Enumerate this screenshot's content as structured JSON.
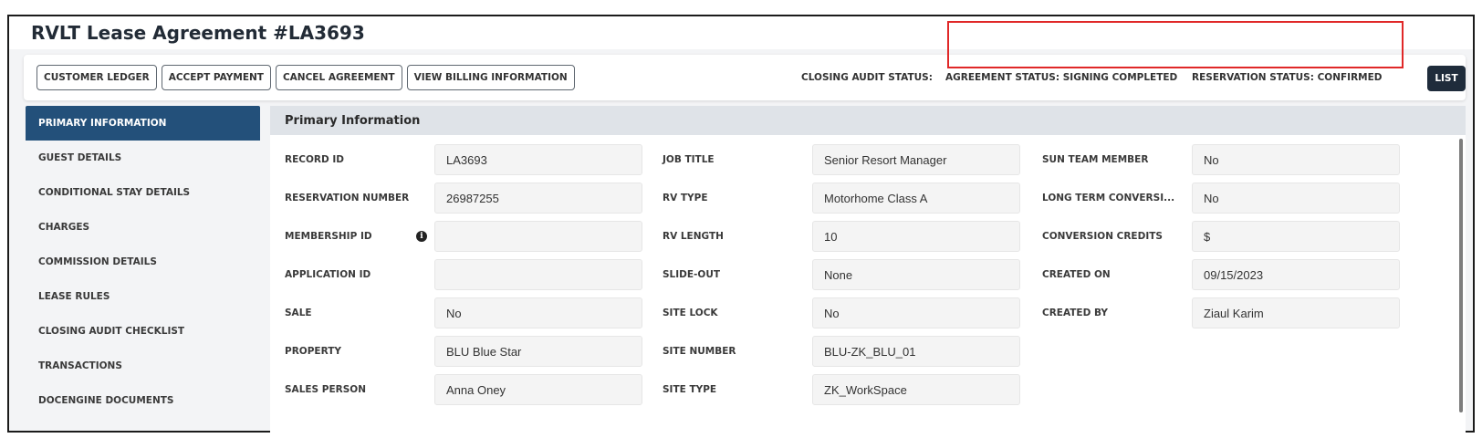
{
  "page": {
    "title": "RVLT Lease Agreement #LA3693"
  },
  "toolbar": {
    "buttons": [
      "CUSTOMER LEDGER",
      "ACCEPT PAYMENT",
      "CANCEL AGREEMENT",
      "VIEW BILLING INFORMATION"
    ],
    "closing_audit_status": "CLOSING AUDIT STATUS:",
    "agreement_status": "AGREEMENT STATUS: SIGNING COMPLETED",
    "reservation_status": "RESERVATION STATUS: CONFIRMED",
    "list_label": "LIST"
  },
  "sidebar": {
    "items": [
      {
        "label": "PRIMARY INFORMATION",
        "active": true
      },
      {
        "label": "GUEST DETAILS"
      },
      {
        "label": "CONDITIONAL STAY DETAILS"
      },
      {
        "label": "CHARGES"
      },
      {
        "label": "COMMISSION DETAILS"
      },
      {
        "label": "LEASE RULES"
      },
      {
        "label": "CLOSING AUDIT CHECKLIST"
      },
      {
        "label": "TRANSACTIONS"
      },
      {
        "label": "DOCENGINE DOCUMENTS"
      }
    ]
  },
  "panel": {
    "title": "Primary Information",
    "columns": [
      [
        {
          "label": "RECORD ID",
          "value": "LA3693"
        },
        {
          "label": "RESERVATION NUMBER",
          "value": "26987255"
        },
        {
          "label": "MEMBERSHIP ID",
          "value": "",
          "info": true
        },
        {
          "label": "APPLICATION ID",
          "value": ""
        },
        {
          "label": "SALE",
          "value": "No"
        },
        {
          "label": "PROPERTY",
          "value": "BLU Blue Star"
        },
        {
          "label": "SALES PERSON",
          "value": "Anna Oney"
        }
      ],
      [
        {
          "label": "JOB TITLE",
          "value": "Senior Resort Manager"
        },
        {
          "label": "RV TYPE",
          "value": "Motorhome Class A"
        },
        {
          "label": "RV LENGTH",
          "value": "10"
        },
        {
          "label": "SLIDE-OUT",
          "value": "None"
        },
        {
          "label": "SITE LOCK",
          "value": "No"
        },
        {
          "label": "SITE NUMBER",
          "value": "BLU-ZK_BLU_01"
        },
        {
          "label": "SITE TYPE",
          "value": "ZK_WorkSpace"
        }
      ],
      [
        {
          "label": "SUN TEAM MEMBER",
          "value": "No"
        },
        {
          "label": "LONG TERM CONVERSI...",
          "value": "No"
        },
        {
          "label": "CONVERSION CREDITS",
          "value": "$"
        },
        {
          "label": "CREATED ON",
          "value": "09/15/2023"
        },
        {
          "label": "CREATED BY",
          "value": "Ziaul Karim"
        }
      ]
    ]
  },
  "colors": {
    "accent": "#23507a",
    "list_button": "#1f2c3b",
    "highlight_box": "#e02828"
  }
}
